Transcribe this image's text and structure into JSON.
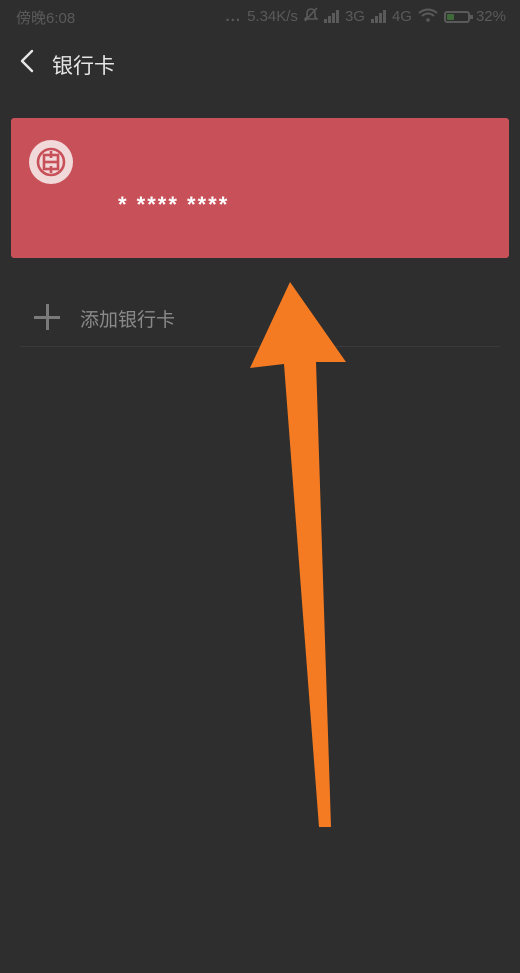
{
  "status_bar": {
    "time": "傍晚6:08",
    "dots": "...",
    "speed": "5.34K/s",
    "network_3g": "3G",
    "network_4g": "4G",
    "battery": "32%",
    "battery_level": 0.32
  },
  "header": {
    "back_icon": "chevron-left-icon",
    "title": "银行卡"
  },
  "bank_card": {
    "logo_icon": "bank-logo-icon",
    "bank_name": "",
    "number": "* **** ****",
    "color": "#c85058"
  },
  "add_card": {
    "icon": "plus-icon",
    "label": "添加银行卡"
  },
  "annotation": {
    "arrow_color": "#f57b22"
  }
}
